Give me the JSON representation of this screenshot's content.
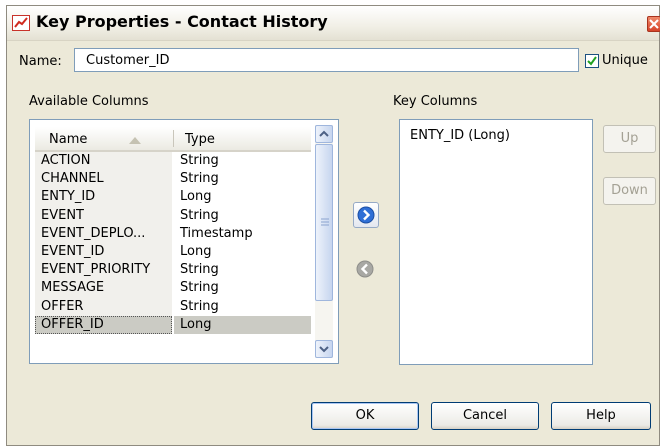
{
  "window": {
    "title": "Key Properties - Contact History"
  },
  "name_field": {
    "label": "Name:",
    "value": "Customer_ID"
  },
  "unique": {
    "label": "Unique",
    "checked": true
  },
  "available_columns": {
    "label": "Available Columns",
    "headers": {
      "name": "Name",
      "type": "Type"
    },
    "sort": "ascending",
    "rows": [
      {
        "name": "ACTION",
        "type": "String"
      },
      {
        "name": "CHANNEL",
        "type": "String"
      },
      {
        "name": "ENTY_ID",
        "type": "Long"
      },
      {
        "name": "EVENT",
        "type": "String"
      },
      {
        "name": "EVENT_DEPLO...",
        "type": "Timestamp"
      },
      {
        "name": "EVENT_ID",
        "type": "Long"
      },
      {
        "name": "EVENT_PRIORITY",
        "type": "String"
      },
      {
        "name": "MESSAGE",
        "type": "String"
      },
      {
        "name": "OFFER",
        "type": "String"
      },
      {
        "name": "OFFER_ID",
        "type": "Long",
        "selected": true
      }
    ]
  },
  "key_columns": {
    "label": "Key Columns",
    "items": [
      "ENTY_ID (Long)"
    ]
  },
  "buttons": {
    "up": "Up",
    "down": "Down",
    "ok": "OK",
    "cancel": "Cancel",
    "help": "Help"
  },
  "icons": {
    "app": "chart-line-icon",
    "close": "close-icon",
    "add": "arrow-right-circle-icon",
    "remove": "arrow-left-circle-icon"
  },
  "colors": {
    "dialog_bg": "#ece9d8",
    "accent_blue": "#2f6fd6",
    "disabled_text": "#a4a194"
  }
}
